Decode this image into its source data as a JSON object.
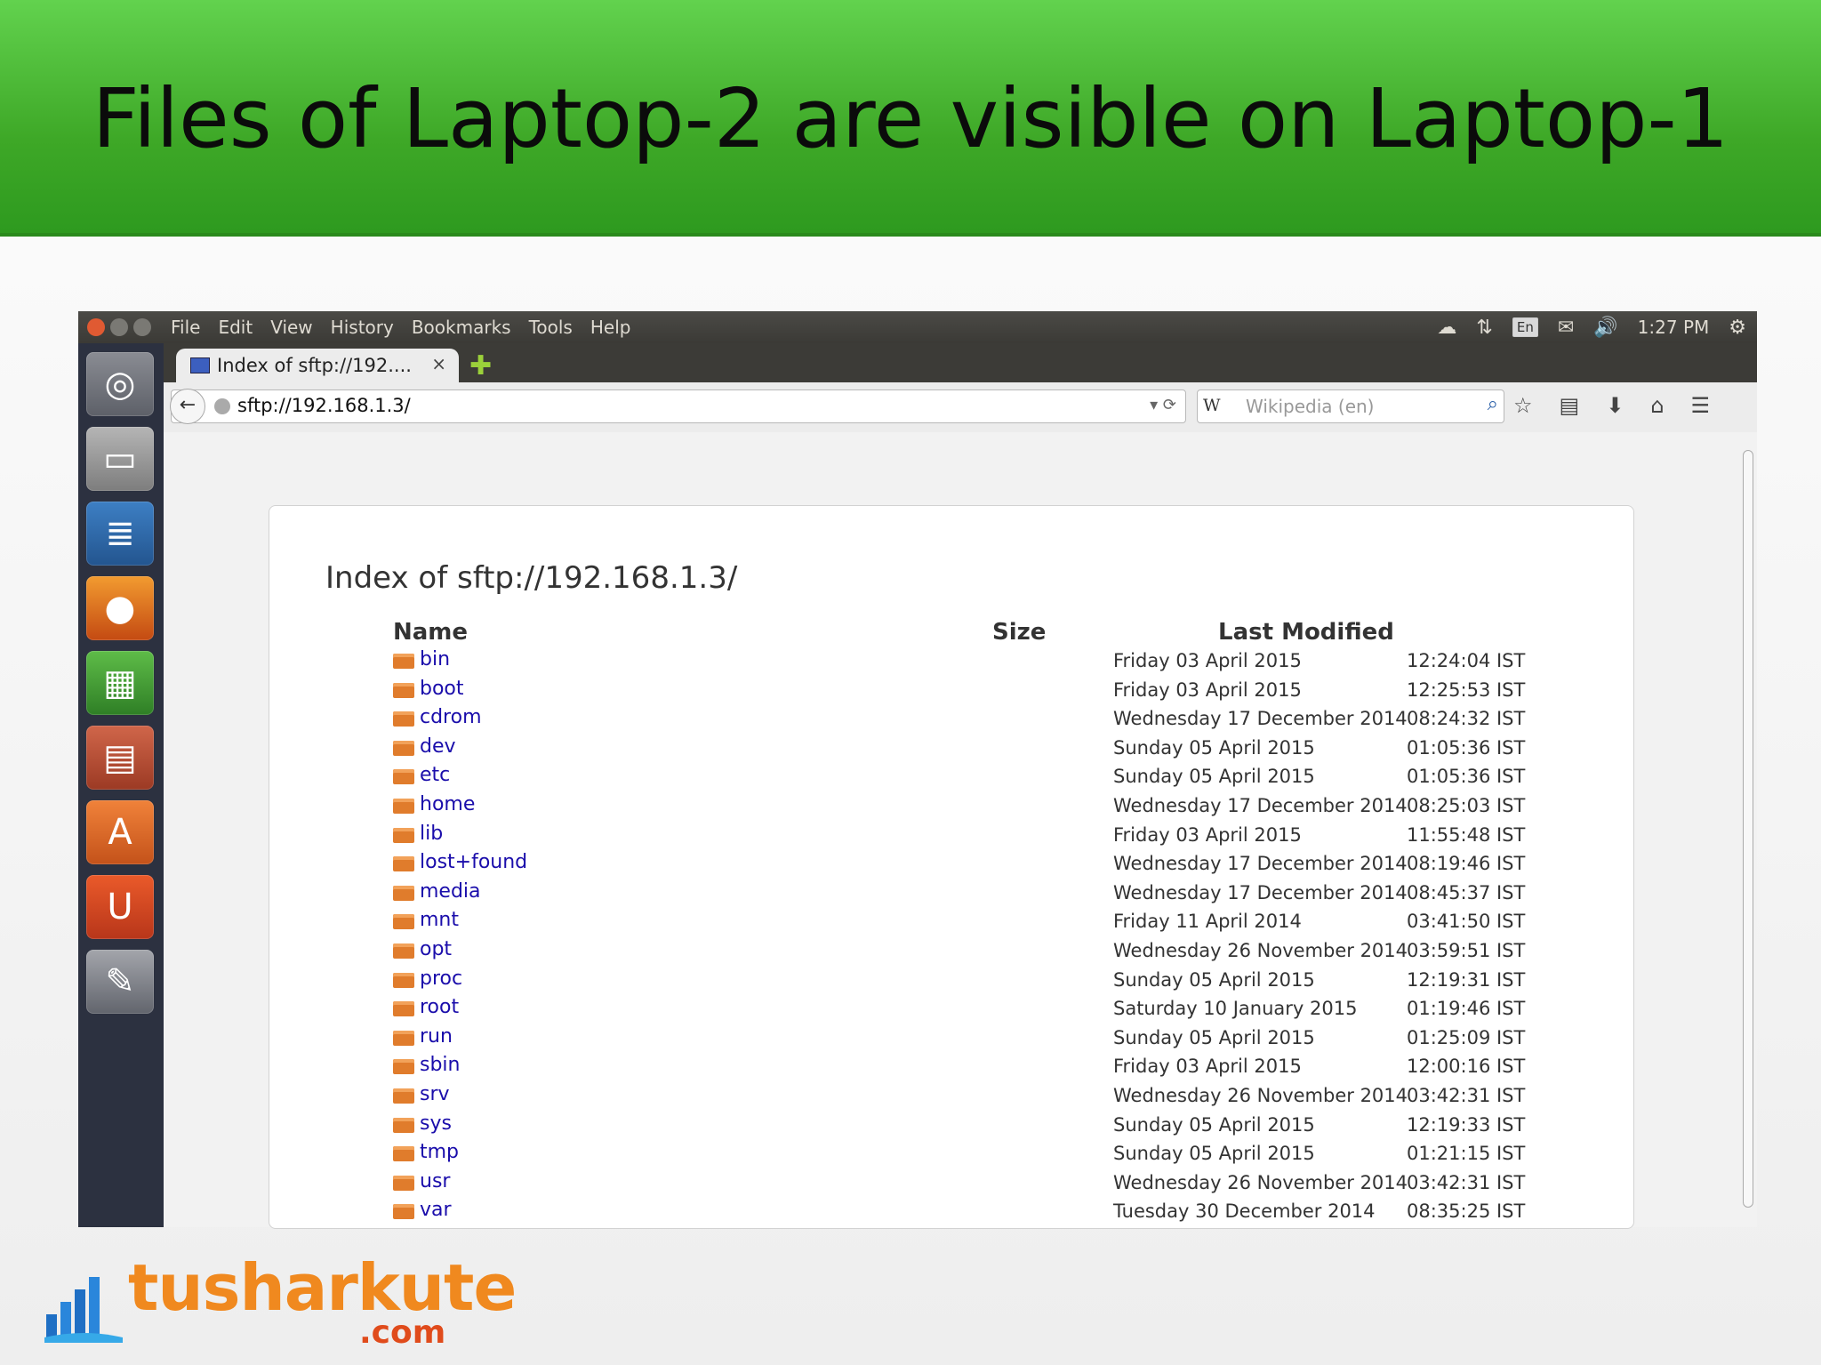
{
  "slide": {
    "title": "Files of Laptop-2 are visible on Laptop-1"
  },
  "menubar": {
    "items": [
      "File",
      "Edit",
      "View",
      "History",
      "Bookmarks",
      "Tools",
      "Help"
    ],
    "language": "En",
    "clock": "1:27 PM"
  },
  "tab": {
    "title": "Index of sftp://192....",
    "close": "×",
    "new": "✚"
  },
  "navbar": {
    "url": "sftp://192.168.1.3/",
    "search_engine": "W",
    "search_placeholder": "Wikipedia (en)"
  },
  "listing": {
    "title": "Index of sftp://192.168.1.3/",
    "headers": {
      "name": "Name",
      "size": "Size",
      "modified": "Last Modified"
    },
    "rows": [
      {
        "name": "bin",
        "date": "Friday 03 April 2015",
        "time": "12:24:04 IST"
      },
      {
        "name": "boot",
        "date": "Friday 03 April 2015",
        "time": "12:25:53 IST"
      },
      {
        "name": "cdrom",
        "date": "Wednesday 17 December 2014",
        "time": "08:24:32 IST"
      },
      {
        "name": "dev",
        "date": "Sunday 05 April 2015",
        "time": "01:05:36 IST"
      },
      {
        "name": "etc",
        "date": "Sunday 05 April 2015",
        "time": "01:05:36 IST"
      },
      {
        "name": "home",
        "date": "Wednesday 17 December 2014",
        "time": "08:25:03 IST"
      },
      {
        "name": "lib",
        "date": "Friday 03 April 2015",
        "time": "11:55:48 IST"
      },
      {
        "name": "lost+found",
        "date": "Wednesday 17 December 2014",
        "time": "08:19:46 IST"
      },
      {
        "name": "media",
        "date": "Wednesday 17 December 2014",
        "time": "08:45:37 IST"
      },
      {
        "name": "mnt",
        "date": "Friday 11 April 2014",
        "time": "03:41:50 IST"
      },
      {
        "name": "opt",
        "date": "Wednesday 26 November 2014",
        "time": "03:59:51 IST"
      },
      {
        "name": "proc",
        "date": "Sunday 05 April 2015",
        "time": "12:19:31 IST"
      },
      {
        "name": "root",
        "date": "Saturday 10 January 2015",
        "time": "01:19:46 IST"
      },
      {
        "name": "run",
        "date": "Sunday 05 April 2015",
        "time": "01:25:09 IST"
      },
      {
        "name": "sbin",
        "date": "Friday 03 April 2015",
        "time": "12:00:16 IST"
      },
      {
        "name": "srv",
        "date": "Wednesday 26 November 2014",
        "time": "03:42:31 IST"
      },
      {
        "name": "sys",
        "date": "Sunday 05 April 2015",
        "time": "12:19:33 IST"
      },
      {
        "name": "tmp",
        "date": "Sunday 05 April 2015",
        "time": "01:21:15 IST"
      },
      {
        "name": "usr",
        "date": "Wednesday 26 November 2014",
        "time": "03:42:31 IST"
      },
      {
        "name": "var",
        "date": "Tuesday 30 December 2014",
        "time": "08:35:25 IST"
      }
    ]
  },
  "logo": {
    "name": "tusharkute",
    "suffix": ".com"
  },
  "colors": {
    "banner": "#3ea827",
    "link": "#1a0dab",
    "folder": "#e07c2c",
    "logo_orange": "#f0891f"
  }
}
